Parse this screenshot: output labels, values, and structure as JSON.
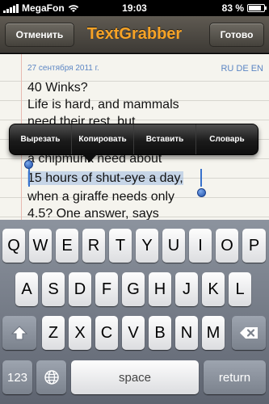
{
  "statusbar": {
    "carrier": "MegaFon",
    "time": "19:03",
    "battery_text": "83 %",
    "battery_level": 0.83
  },
  "navbar": {
    "cancel_label": "Отменить",
    "title": "TextGrabber",
    "done_label": "Готово"
  },
  "document": {
    "date": "27 сентября 2011 г.",
    "languages": "RU DE EN",
    "lines": [
      "40 Winks?",
      "Life is hard, and mammals",
      "need their rest, but",
      "a chipmunk need about",
      "15 hours of shut-eye a day,",
      "when a giraffe needs only",
      "4.5? One answer, says"
    ]
  },
  "edit_menu": {
    "cut": "Вырезать",
    "copy": "Копировать",
    "paste": "Вставить",
    "dictionary": "Словарь"
  },
  "keyboard": {
    "row1": [
      "Q",
      "W",
      "E",
      "R",
      "T",
      "Y",
      "U",
      "I",
      "O",
      "P"
    ],
    "row2": [
      "A",
      "S",
      "D",
      "F",
      "G",
      "H",
      "J",
      "K",
      "L"
    ],
    "row3": [
      "Z",
      "X",
      "C",
      "V",
      "B",
      "N",
      "M"
    ],
    "numbers_key": "123",
    "space_key": "space",
    "return_key": "return",
    "shift_icon": "shift-icon",
    "backspace_icon": "backspace-icon",
    "globe_icon": "globe-icon"
  }
}
